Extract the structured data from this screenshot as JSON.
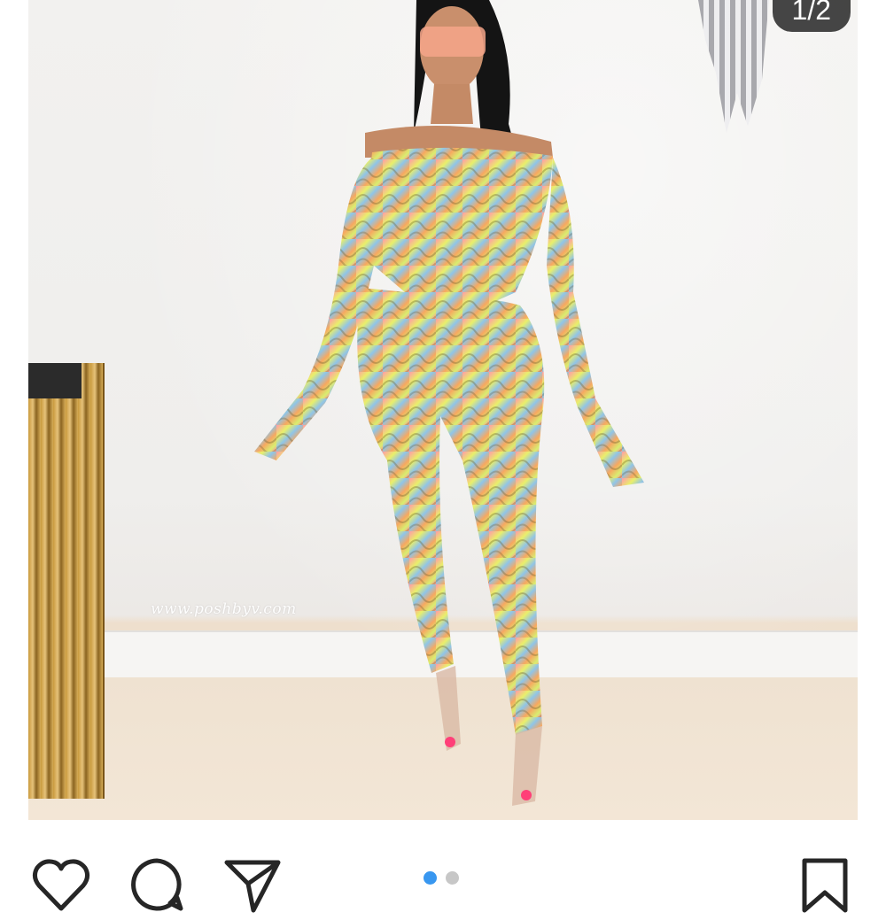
{
  "post": {
    "image_alt": "Model wearing a multicolor swirl print off-shoulder bodysuit and leggings set",
    "watermark": "www.poshbyv.com",
    "carousel_counter": "1/2"
  },
  "actions": {
    "like_icon": "heart-icon",
    "comment_icon": "comment-icon",
    "share_icon": "send-icon",
    "save_icon": "bookmark-icon"
  },
  "carousel": {
    "total": 2,
    "active": 1,
    "active_color": "#3897f0",
    "inactive_color": "#c7c7c7"
  }
}
